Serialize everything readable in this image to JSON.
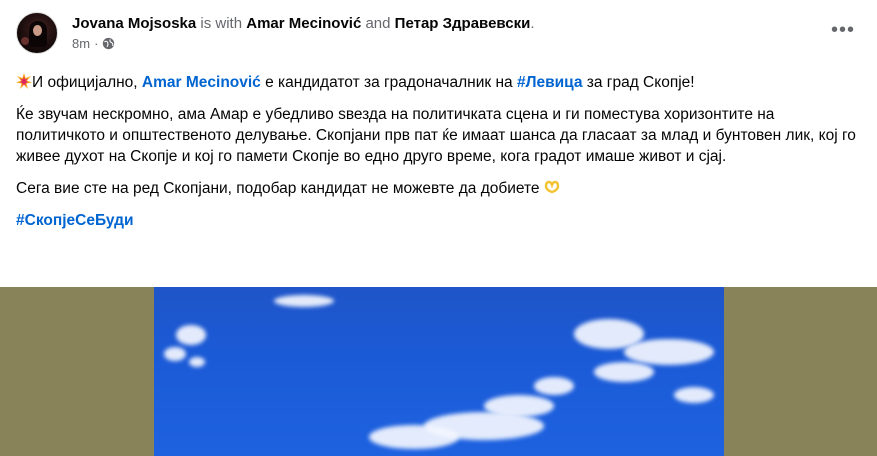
{
  "post": {
    "author": "Jovana Mojsoska",
    "with_text": "is with",
    "tagged_1": "Amar Mecinović",
    "and_text": "and",
    "tagged_2": "Петар Здравевски",
    "period": ".",
    "time": "8m",
    "dot": "·",
    "privacy_icon": "globe-icon",
    "more_icon": "more-options-icon"
  },
  "content": {
    "line1_prefix": "И официјално, ",
    "line1_mention": "Amar Mecinović",
    "line1_mid": " е кандидатот за градоначалник на ",
    "line1_hashtag": "#Левица",
    "line1_suffix": " за град Скопје!",
    "paragraph2": "Ќе звучам нескромно, ама Амар е убедливо ѕвезда на политичката сцена и ги поместува хоризонтите на политичкото и општественото делување. Скопјани прв пат ќе имаат шанса да гласаат за млад и бунтовен лик, кој го живее духот на Скопје и кој го памети Скопје во едно друго време, кога градот имаше живот и сјај.",
    "paragraph3": "Сега вие сте на ред Скопјани, подобар кандидат не можевте да добиете",
    "hashtag": "#СкопјеСеБуди"
  },
  "colors": {
    "link": "#0064d1",
    "muted": "#65676b",
    "media_frame": "#888358",
    "sky": "#1e5cd6"
  }
}
